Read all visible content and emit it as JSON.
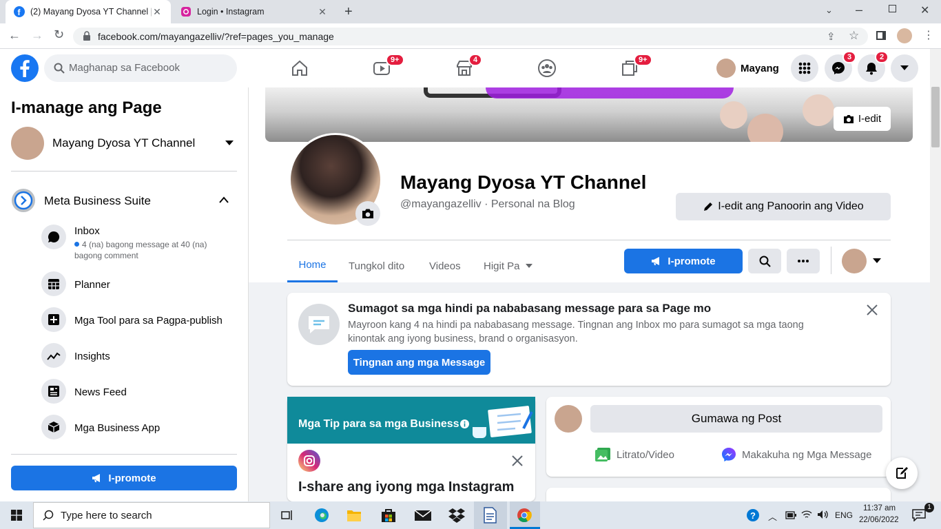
{
  "browser": {
    "tabs": [
      {
        "title": "(2) Mayang Dyosa YT Channel | F",
        "active": true
      },
      {
        "title": "Login • Instagram",
        "active": false
      }
    ],
    "url": "facebook.com/mayangazelliv/?ref=pages_you_manage"
  },
  "header": {
    "search_placeholder": "Maghanap sa Facebook",
    "nav_badges": {
      "watch": "9+",
      "marketplace": "4",
      "gaming": "9+"
    },
    "profile_name": "Mayang",
    "messenger_badge": "3",
    "notif_badge": "2"
  },
  "sidebar": {
    "title": "I-manage ang Page",
    "page_name": "Mayang Dyosa YT Channel",
    "suite": "Meta Business Suite",
    "items": [
      {
        "label": "Inbox",
        "sub": "4 (na) bagong message at 40 (na) bagong comment"
      },
      {
        "label": "Planner"
      },
      {
        "label": "Mga Tool para sa Pagpa-publish"
      },
      {
        "label": "Insights"
      },
      {
        "label": "News Feed"
      },
      {
        "label": "Mga Business App"
      }
    ],
    "promote": "I-promote"
  },
  "cover": {
    "edit": "I-edit"
  },
  "profile": {
    "name": "Mayang Dyosa YT Channel",
    "handle": "@mayangazelliv · Personal na Blog",
    "edit_button": "I-edit ang Panoorin ang Video"
  },
  "tabs": {
    "home": "Home",
    "about": "Tungkol dito",
    "videos": "Videos",
    "more": "Higit Pa",
    "promote": "I-promote"
  },
  "notice": {
    "title": "Sumagot sa mga hindi pa nababasang message para sa Page mo",
    "body": "Mayroon kang 4 na hindi pa nababasang message. Tingnan ang Inbox mo para sumagot sa mga taong kinontak ang iyong business, brand o organisasyon.",
    "button": "Tingnan ang mga Message"
  },
  "tips": {
    "header": "Mga Tip para sa mga Business",
    "title": "I-share ang iyong mga Instagram"
  },
  "post": {
    "create": "Gumawa ng Post",
    "photo": "Litrato/Video",
    "messages": "Makakuha ng Mga Message"
  },
  "taskbar": {
    "search": "Type here to search",
    "lang": "ENG",
    "time": "11:37 am",
    "date": "22/06/2022"
  },
  "colors": {
    "fb_blue": "#1b74e4",
    "badge_red": "#e41e3f",
    "teal": "#0f8a9a"
  }
}
